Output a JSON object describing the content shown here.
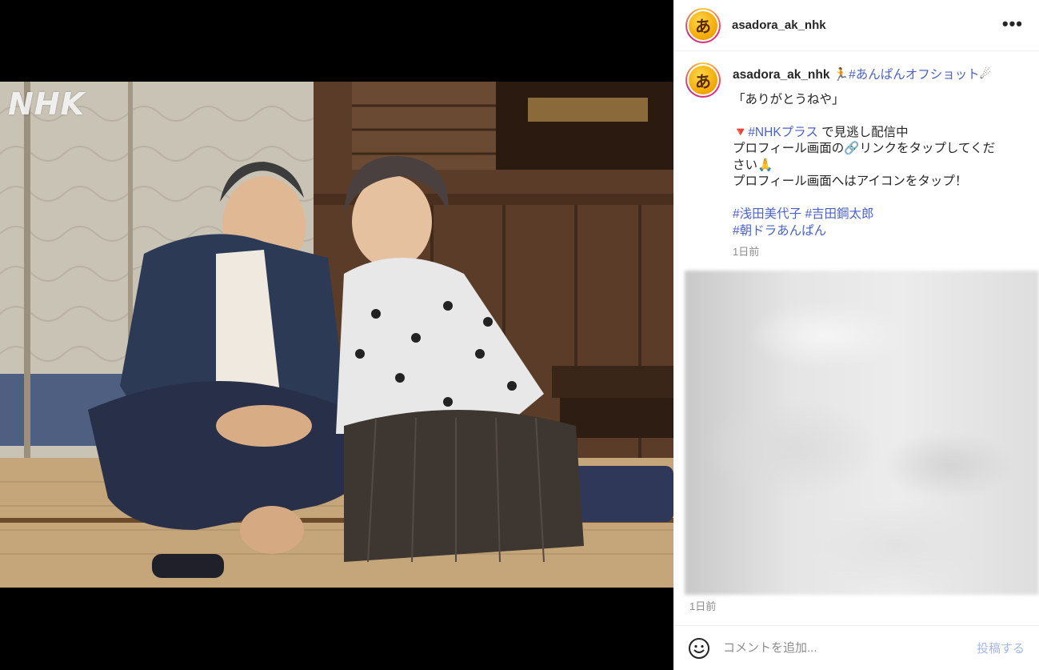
{
  "media": {
    "watermark": "NHK"
  },
  "header": {
    "username": "asadora_ak_nhk",
    "avatar_glyph": "あ",
    "more_icon": "more-horizontal-icon"
  },
  "caption": {
    "username": "asadora_ak_nhk",
    "runner_emoji": "🏃",
    "hashtag_offshot": "#あんぱんオフショット",
    "sparkle_emoji": "☄",
    "quote": "「ありがとうねや」",
    "triangle_emoji": "🔻",
    "hashtag_nhkplus": "#NHKプラス",
    "line_stream": " で見逃し配信中",
    "line_profile_1": "プロフィール画面の",
    "link_emoji": "🔗",
    "line_profile_1b": "リンクをタップしてくだ",
    "line_profile_2": "さい",
    "pray_emoji": "🙏",
    "line_profile_3": "プロフィール画面へはアイコンをタップ！",
    "hashtag_asada": "#浅田美代子",
    "hashtag_yoshida": "#吉田鋼太郎",
    "hashtag_asadora": "#朝ドラあんぱん",
    "time": "1日前"
  },
  "comments": {
    "time": "1日前"
  },
  "comment_bar": {
    "emoji_icon": "smile-icon",
    "placeholder": "コメントを追加...",
    "post_label": "投稿する"
  },
  "colors": {
    "hashtag": "#4a62c8",
    "post_disabled": "#a5b9e6",
    "meta": "#8e8e8e"
  }
}
